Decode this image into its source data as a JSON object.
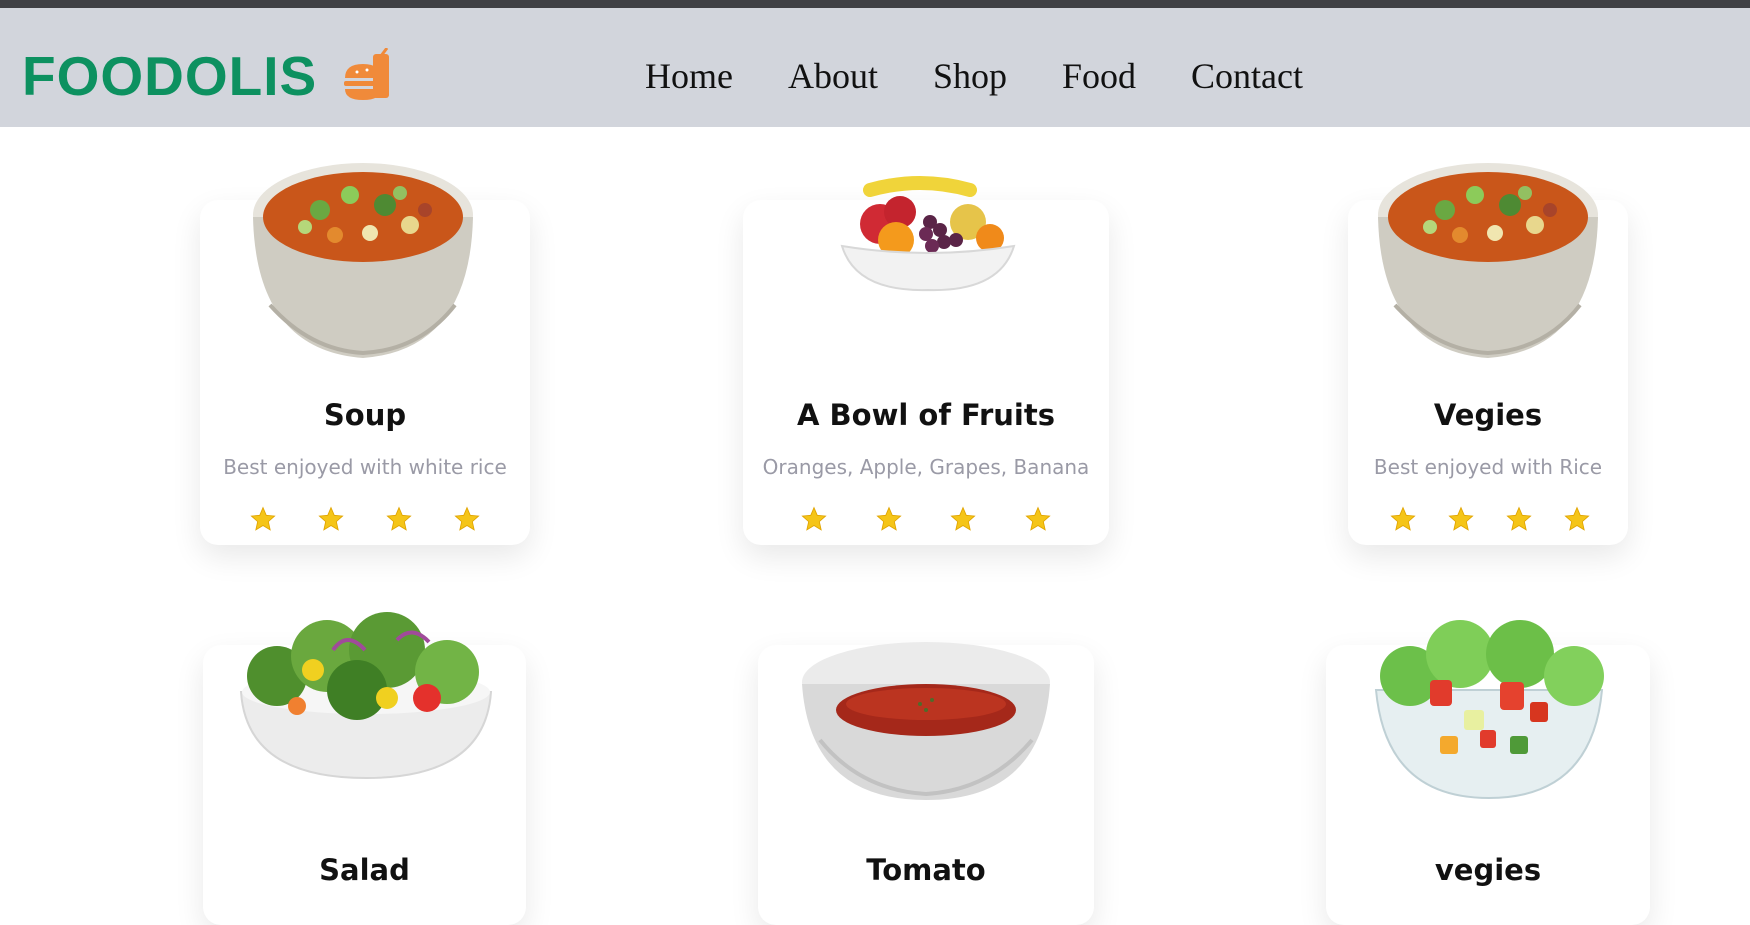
{
  "brand": {
    "name": "FOODOLIS",
    "icon": "burger-drink-icon",
    "color": "#0d9160",
    "icon_color": "#f08a3a"
  },
  "nav": {
    "items": [
      "Home",
      "About",
      "Shop",
      "Food",
      "Contact"
    ]
  },
  "cards": [
    {
      "title": "Soup",
      "description": "Best enjoyed with white rice",
      "rating": 4,
      "image": "vegetable-soup-bowl"
    },
    {
      "title": "A Bowl of Fruits",
      "description": "Oranges, Apple, Grapes, Banana",
      "rating": 4,
      "image": "fruit-bowl"
    },
    {
      "title": "Vegies",
      "description": "Best enjoyed with Rice",
      "rating": 4,
      "image": "vegetable-soup-bowl"
    },
    {
      "title": "Salad",
      "description": "",
      "image": "green-salad-bowl"
    },
    {
      "title": "Tomato",
      "description": "",
      "image": "tomato-soup-bowl"
    },
    {
      "title": "vegies",
      "description": "",
      "image": "vegetable-salad-glass-bowl"
    }
  ],
  "colors": {
    "navbar_bg": "#d2d5dc",
    "star": "#f5c518",
    "description_text": "#9a9aa6"
  }
}
